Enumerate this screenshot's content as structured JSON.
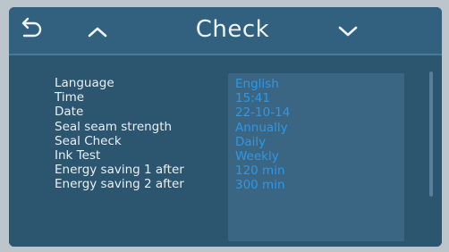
{
  "header": {
    "title": "Check",
    "back_icon": "back-arrow-icon",
    "up_icon": "chevron-up-icon",
    "down_icon": "chevron-down-icon"
  },
  "settings": {
    "labels": [
      "Language",
      "Time",
      "Date",
      "Seal seam strength",
      "Seal Check",
      "Ink Test",
      "Energy saving 1 after",
      "Energy saving 2 after"
    ],
    "values": [
      "English",
      "15:41",
      "22-10-14",
      "Annually",
      "Daily",
      "Weekly",
      "120 min",
      "300 min"
    ]
  },
  "colors": {
    "background": "#2f5874",
    "header": "#32607f",
    "value_text": "#2f97e4",
    "label_text": "#e9f0f5"
  }
}
